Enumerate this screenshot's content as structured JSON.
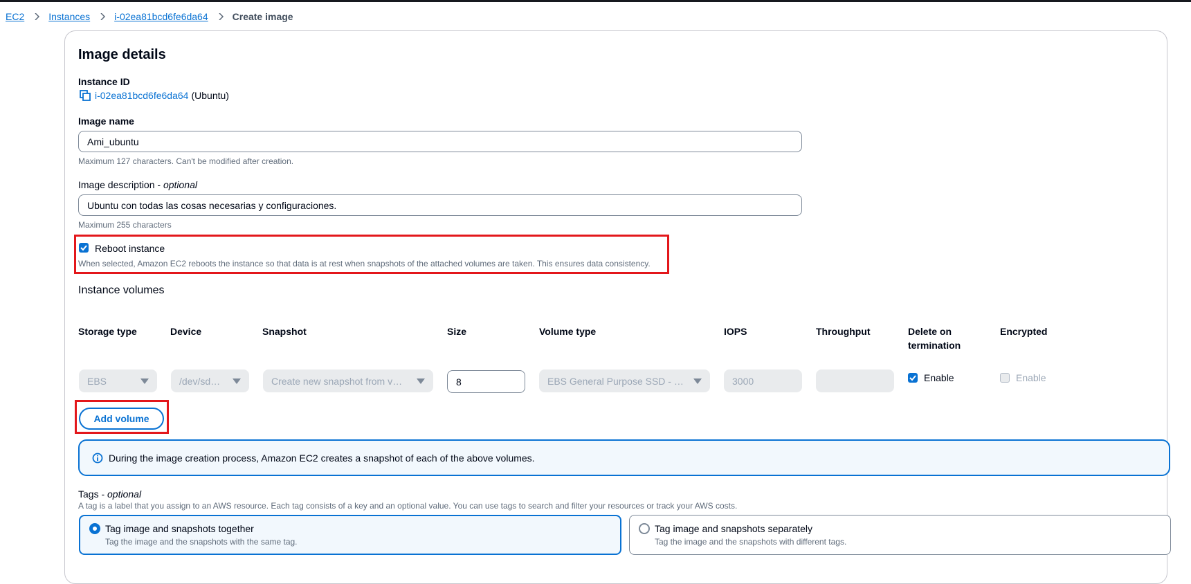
{
  "breadcrumb": {
    "items": [
      "EC2",
      "Instances",
      "i-02ea81bcd6fe6da64"
    ],
    "current": "Create image"
  },
  "image_details": {
    "title": "Image details",
    "instance_id_label": "Instance ID",
    "instance_id": "i-02ea81bcd6fe6da64",
    "instance_os": "(Ubuntu)",
    "image_name_label": "Image name",
    "image_name_value": "Ami_ubuntu",
    "image_name_hint": "Maximum 127 characters. Can't be modified after creation.",
    "description_label": "Image description - ",
    "description_optional": "optional",
    "description_value": "Ubuntu con todas las cosas necesarias y configuraciones.",
    "description_hint": "Maximum 255 characters",
    "reboot_label": "Reboot instance",
    "reboot_checked": true,
    "reboot_hint": "When selected, Amazon EC2 reboots the instance so that data is at rest when snapshots of the attached volumes are taken. This ensures data consistency."
  },
  "volumes": {
    "title": "Instance volumes",
    "headers": [
      "Storage type",
      "Device",
      "Snapshot",
      "Size",
      "Volume type",
      "IOPS",
      "Throughput",
      "Delete on termination",
      "Encrypted"
    ],
    "row": {
      "storage_type": "EBS",
      "device": "/dev/sd…",
      "snapshot": "Create new snapshot from v…",
      "size": "8",
      "volume_type": "EBS General Purpose SSD - …",
      "iops": "3000",
      "throughput": "",
      "delete_on_termination_label": "Enable",
      "delete_on_termination_checked": true,
      "encrypted_label": "Enable",
      "encrypted_checked": false
    },
    "add_volume_label": "Add volume"
  },
  "info_alert": "During the image creation process, Amazon EC2 creates a snapshot of each of the above volumes.",
  "tags": {
    "label": "Tags - ",
    "optional": "optional",
    "description": "A tag is a label that you assign to an AWS resource. Each tag consists of a key and an optional value. You can use tags to search and filter your resources or track your AWS costs.",
    "options": [
      {
        "title": "Tag image and snapshots together",
        "desc": "Tag the image and the snapshots with the same tag.",
        "selected": true
      },
      {
        "title": "Tag image and snapshots separately",
        "desc": "Tag the image and the snapshots with different tags.",
        "selected": false
      }
    ]
  },
  "colors": {
    "link": "#0972d3",
    "highlight": "#e3171b",
    "text": "#000716",
    "hint": "#5f6b7a"
  }
}
